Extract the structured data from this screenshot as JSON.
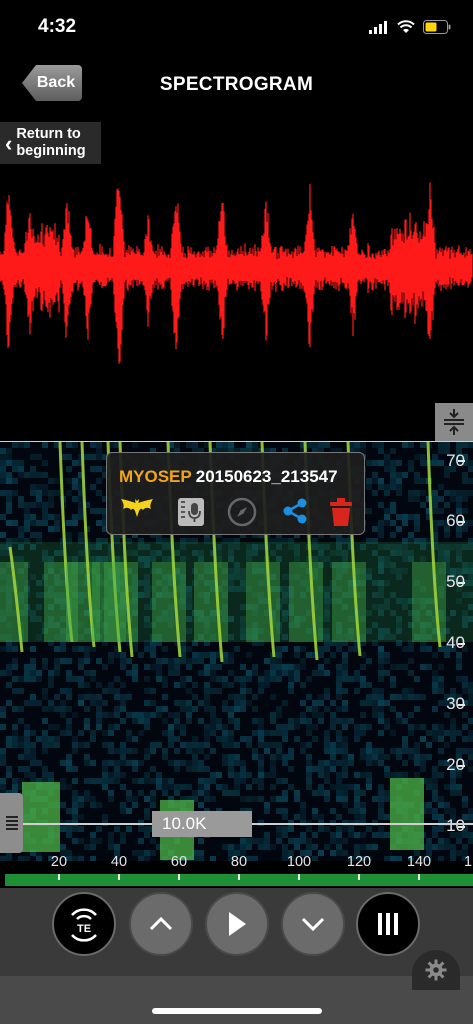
{
  "status": {
    "time": "4:32"
  },
  "nav": {
    "back_label": "Back",
    "title": "SPECTROGRAM"
  },
  "return_button": {
    "line1": "Return to",
    "line2": "beginning"
  },
  "info": {
    "species": "MYOSEP",
    "file": "20150623_213547",
    "icons": [
      "bat-icon",
      "microphone-notes-icon",
      "compass-icon",
      "share-icon",
      "trash-icon"
    ]
  },
  "freq_axis": [
    "70",
    "60",
    "50",
    "40",
    "30",
    "20",
    "10"
  ],
  "reference": {
    "label": "10.0K"
  },
  "time_axis": [
    "20",
    "40",
    "60",
    "80",
    "100",
    "120",
    "140",
    "1"
  ],
  "controls": [
    "te-logo-button",
    "scroll-up-button",
    "play-button",
    "scroll-down-button",
    "pause-bars-button"
  ],
  "colors": {
    "waveform": "#ff1a1a",
    "accent_orange": "#f2a51b",
    "share_blue": "#1d8fe0",
    "trash_red": "#d9261c",
    "track_green": "#1f8f36"
  }
}
